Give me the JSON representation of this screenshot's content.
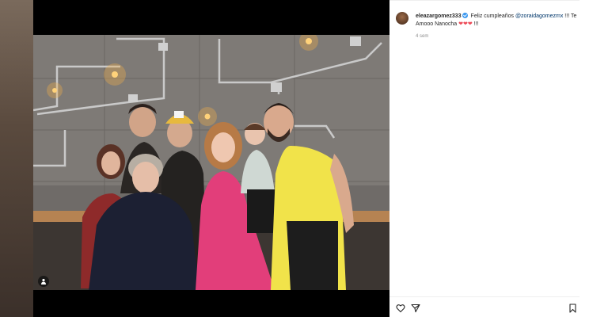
{
  "comment": {
    "username": "eleazargomez333",
    "text_before_mention": " Feliz cumpleaños ",
    "mention": "@zoraidagomezmx",
    "text_after_mention": " !!! Te Amooo Nanocha ",
    "text_end": " !!!",
    "timestamp": "4 sem"
  },
  "colors": {
    "verified": "#3897f0",
    "mention": "#00376b",
    "heart": "#ed4956",
    "muted": "#8e8e8e"
  },
  "icons": {
    "like": "heart-icon",
    "share": "send-icon",
    "save": "bookmark-icon",
    "tagged_people": "person-icon"
  }
}
